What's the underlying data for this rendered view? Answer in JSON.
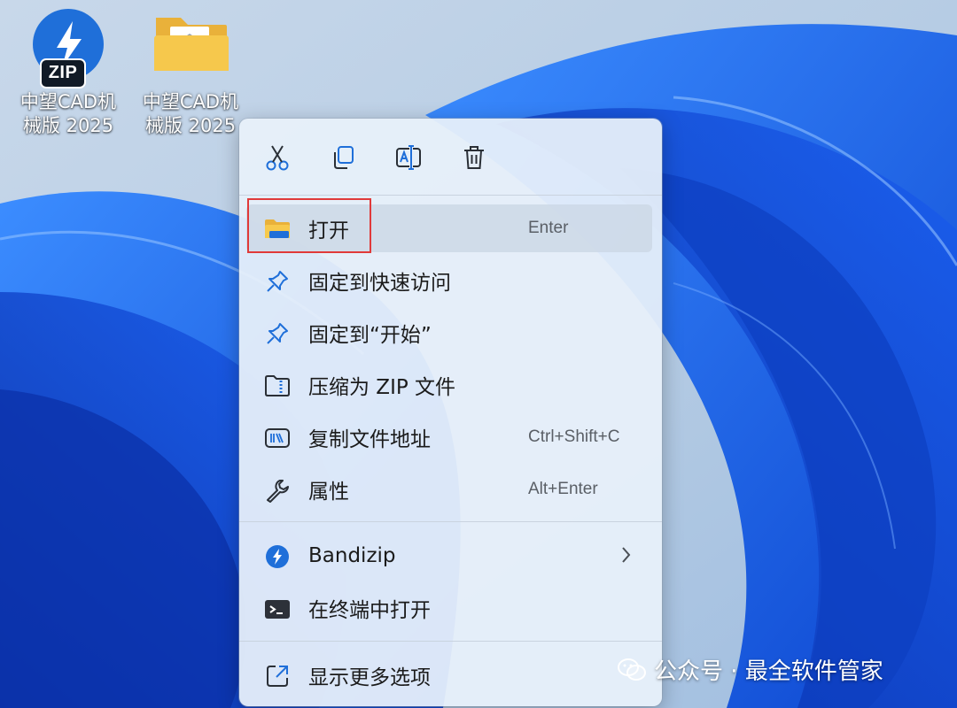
{
  "desktop": {
    "icons": [
      {
        "label": "中望CAD机\n械版 2025",
        "badge": "ZIP",
        "icon": "zip-archive-icon"
      },
      {
        "label": "中望CAD机\n械版 2025",
        "icon": "folder-icon"
      }
    ]
  },
  "context_menu": {
    "toolbar": [
      {
        "name": "cut",
        "icon": "scissors-icon"
      },
      {
        "name": "copy",
        "icon": "copy-icon"
      },
      {
        "name": "rename",
        "icon": "rename-icon"
      },
      {
        "name": "delete",
        "icon": "trash-icon"
      }
    ],
    "items": [
      {
        "label": "打开",
        "shortcut": "Enter",
        "icon": "folder-open-icon",
        "highlighted": true
      },
      {
        "label": "固定到快速访问",
        "shortcut": "",
        "icon": "pin-icon"
      },
      {
        "label": "固定到“开始”",
        "shortcut": "",
        "icon": "pin-icon"
      },
      {
        "label": "压缩为 ZIP 文件",
        "shortcut": "",
        "icon": "zip-folder-icon"
      },
      {
        "label": "复制文件地址",
        "shortcut": "Ctrl+Shift+C",
        "icon": "path-icon"
      },
      {
        "label": "属性",
        "shortcut": "Alt+Enter",
        "icon": "wrench-icon"
      },
      {
        "label": "Bandizip",
        "shortcut": "",
        "icon": "bandizip-icon",
        "submenu": true
      },
      {
        "label": "在终端中打开",
        "shortcut": "",
        "icon": "terminal-icon"
      },
      {
        "label": "显示更多选项",
        "shortcut": "",
        "icon": "external-icon"
      }
    ]
  },
  "watermark": {
    "text": "公众号 · 最全软件管家"
  },
  "colors": {
    "accent": "#1f6fd9",
    "highlight_border": "#e03a3a",
    "menu_bg": "#e8f0fa"
  }
}
